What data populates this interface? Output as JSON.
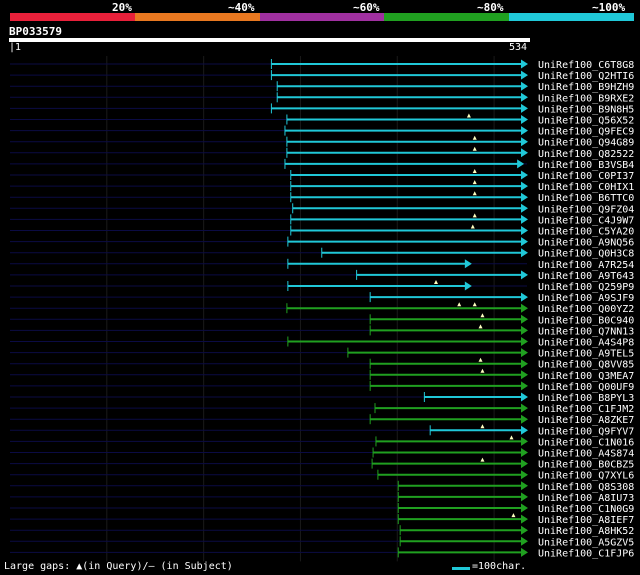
{
  "identity_scale": {
    "labels": [
      "20%",
      "~40%",
      "~60%",
      "~80%",
      "~100%"
    ],
    "colors": [
      "#e8203a",
      "#e87820",
      "#a030a0",
      "#20a020",
      "#20c8d8"
    ]
  },
  "query": {
    "id": "BP033579",
    "start": "1",
    "end": "534",
    "length": 534
  },
  "hits": [
    {
      "name": "UniRef100_C6T8G8",
      "start": 270,
      "end": 534,
      "identity": "~100%",
      "marks": []
    },
    {
      "name": "UniRef100_Q2HTI6",
      "start": 270,
      "end": 534,
      "identity": "~100%",
      "marks": []
    },
    {
      "name": "UniRef100_B9HZH9",
      "start": 276,
      "end": 534,
      "identity": "~100%",
      "marks": []
    },
    {
      "name": "UniRef100_B9RXE2",
      "start": 276,
      "end": 534,
      "identity": "~100%",
      "marks": []
    },
    {
      "name": "UniRef100_B9N8H5",
      "start": 270,
      "end": 534,
      "identity": "~100%",
      "marks": []
    },
    {
      "name": "UniRef100_Q56X52",
      "start": 286,
      "end": 534,
      "identity": "~100%",
      "marks": [
        474
      ]
    },
    {
      "name": "UniRef100_Q9FEC9",
      "start": 284,
      "end": 534,
      "identity": "~100%",
      "marks": []
    },
    {
      "name": "UniRef100_Q94G89",
      "start": 286,
      "end": 534,
      "identity": "~100%",
      "marks": [
        480
      ]
    },
    {
      "name": "UniRef100_Q82522",
      "start": 286,
      "end": 534,
      "identity": "~100%",
      "marks": [
        480
      ]
    },
    {
      "name": "UniRef100_B3VSB4",
      "start": 284,
      "end": 530,
      "identity": "~100%",
      "marks": []
    },
    {
      "name": "UniRef100_C0PI37",
      "start": 290,
      "end": 534,
      "identity": "~100%",
      "marks": [
        480
      ]
    },
    {
      "name": "UniRef100_C0HIX1",
      "start": 290,
      "end": 534,
      "identity": "~100%",
      "marks": [
        480
      ]
    },
    {
      "name": "UniRef100_B6TTC0",
      "start": 290,
      "end": 534,
      "identity": "~100%",
      "marks": [
        480
      ]
    },
    {
      "name": "UniRef100_Q9FZ04",
      "start": 292,
      "end": 534,
      "identity": "~100%",
      "marks": []
    },
    {
      "name": "UniRef100_C4J9W7",
      "start": 290,
      "end": 534,
      "identity": "~100%",
      "marks": [
        480
      ]
    },
    {
      "name": "UniRef100_C5YA20",
      "start": 290,
      "end": 534,
      "identity": "~100%",
      "marks": [
        478
      ]
    },
    {
      "name": "UniRef100_A9NQ56",
      "start": 287,
      "end": 534,
      "identity": "~100%",
      "marks": []
    },
    {
      "name": "UniRef100_Q0H3C8",
      "start": 322,
      "end": 534,
      "identity": "~100%",
      "marks": []
    },
    {
      "name": "UniRef100_A7R254",
      "start": 287,
      "end": 476,
      "identity": "~100%",
      "marks": []
    },
    {
      "name": "UniRef100_A9T643",
      "start": 358,
      "end": 534,
      "identity": "~100%",
      "marks": []
    },
    {
      "name": "UniRef100_Q259P9",
      "start": 287,
      "end": 476,
      "identity": "~100%",
      "marks": [
        440
      ]
    },
    {
      "name": "UniRef100_A9SJF9",
      "start": 372,
      "end": 534,
      "identity": "~100%",
      "marks": []
    },
    {
      "name": "UniRef100_Q00YZ2",
      "start": 286,
      "end": 534,
      "identity": "~80%",
      "marks": [
        464,
        480
      ]
    },
    {
      "name": "UniRef100_B0C940",
      "start": 372,
      "end": 534,
      "identity": "~80%",
      "marks": [
        488
      ]
    },
    {
      "name": "UniRef100_Q7NN13",
      "start": 372,
      "end": 534,
      "identity": "~80%",
      "marks": [
        486
      ]
    },
    {
      "name": "UniRef100_A4S4P8",
      "start": 287,
      "end": 534,
      "identity": "~80%",
      "marks": []
    },
    {
      "name": "UniRef100_A9TEL5",
      "start": 349,
      "end": 534,
      "identity": "~80%",
      "marks": []
    },
    {
      "name": "UniRef100_Q8VV85",
      "start": 372,
      "end": 534,
      "identity": "~80%",
      "marks": [
        486
      ]
    },
    {
      "name": "UniRef100_Q3MEA7",
      "start": 372,
      "end": 534,
      "identity": "~80%",
      "marks": [
        488
      ]
    },
    {
      "name": "UniRef100_Q00UF9",
      "start": 372,
      "end": 534,
      "identity": "~80%",
      "marks": []
    },
    {
      "name": "UniRef100_B8PYL3",
      "start": 428,
      "end": 534,
      "identity": "~100%",
      "marks": []
    },
    {
      "name": "UniRef100_C1FJM2",
      "start": 377,
      "end": 534,
      "identity": "~80%",
      "marks": []
    },
    {
      "name": "UniRef100_A8ZKE7",
      "start": 372,
      "end": 534,
      "identity": "~80%",
      "marks": []
    },
    {
      "name": "UniRef100_Q9FYV7",
      "start": 434,
      "end": 534,
      "identity": "~100%",
      "marks": [
        488
      ]
    },
    {
      "name": "UniRef100_C1N016",
      "start": 378,
      "end": 534,
      "identity": "~80%",
      "marks": [
        518
      ]
    },
    {
      "name": "UniRef100_A4S874",
      "start": 375,
      "end": 534,
      "identity": "~80%",
      "marks": []
    },
    {
      "name": "UniRef100_B0CBZ5",
      "start": 374,
      "end": 534,
      "identity": "~80%",
      "marks": [
        488
      ]
    },
    {
      "name": "UniRef100_Q7XYL6",
      "start": 380,
      "end": 534,
      "identity": "~80%",
      "marks": []
    },
    {
      "name": "UniRef100_Q8S308",
      "start": 401,
      "end": 534,
      "identity": "~80%",
      "marks": []
    },
    {
      "name": "UniRef100_A8IU73",
      "start": 401,
      "end": 534,
      "identity": "~80%",
      "marks": []
    },
    {
      "name": "UniRef100_C1N0G9",
      "start": 401,
      "end": 534,
      "identity": "~80%",
      "marks": []
    },
    {
      "name": "UniRef100_A8IEF7",
      "start": 401,
      "end": 534,
      "identity": "~80%",
      "marks": [
        520
      ]
    },
    {
      "name": "UniRef100_A8HK52",
      "start": 403,
      "end": 534,
      "identity": "~80%",
      "marks": []
    },
    {
      "name": "UniRef100_A5GZV5",
      "start": 403,
      "end": 534,
      "identity": "~80%",
      "marks": []
    },
    {
      "name": "UniRef100_C1FJP6",
      "start": 401,
      "end": 534,
      "identity": "~80%",
      "marks": []
    }
  ],
  "footer": {
    "gaps_text": "Large gaps: ▲(in Query)/– (in Subject)",
    "legend_text": "=100char."
  }
}
